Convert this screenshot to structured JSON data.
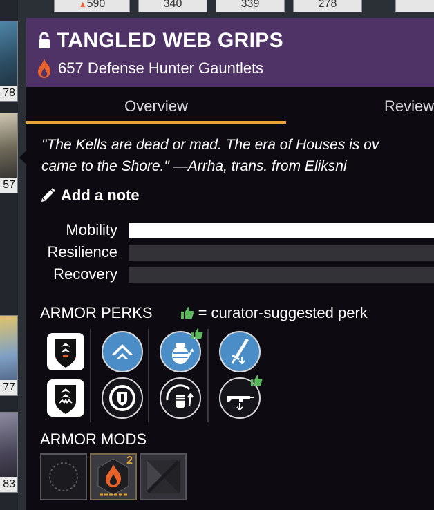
{
  "background": {
    "left_tiles": [
      "78",
      "57",
      "77",
      "83"
    ],
    "top_tiles": [
      "590",
      "340",
      "339",
      "278"
    ]
  },
  "item": {
    "name": "TANGLED WEB GRIPS",
    "power": "657",
    "subtitle": "657 Defense Hunter Gauntlets",
    "locked": true,
    "element": "solar"
  },
  "tabs": [
    {
      "label": "Overview",
      "active": true
    },
    {
      "label": "Review",
      "active": false
    }
  ],
  "flavor_text": "\"The Kells are dead or mad. The era of Houses is ov\ncame to the Shore.\" —Arrha, trans. from Eliksni",
  "add_note_label": "Add a note",
  "stats": [
    {
      "label": "Mobility",
      "value_fraction": 1.0
    },
    {
      "label": "Resilience",
      "value_fraction": 0.0
    },
    {
      "label": "Recovery",
      "value_fraction": 0.0
    }
  ],
  "perks": {
    "title": "ARMOR PERKS",
    "curator_legend": "= curator-suggested perk",
    "columns": [
      {
        "top": "armor-tier-icon",
        "bottom": "armor-tier-icon"
      },
      {
        "top": "chevron-up-icon",
        "bottom": "shield-icon"
      },
      {
        "top": "grenade-icon",
        "bottom": "fist-icon",
        "top_curated": true
      },
      {
        "top": "sword-icon",
        "bottom": "heavy-weapon-icon",
        "bottom_curated": true
      }
    ]
  },
  "mods": {
    "title": "ARMOR MODS",
    "items": [
      {
        "icon": "empty-socket-icon"
      },
      {
        "icon": "solar-energy-icon",
        "cost": "2"
      },
      {
        "icon": "empty-mod-icon"
      }
    ]
  },
  "colors": {
    "header_bg": "#4f3366",
    "popup_bg": "#0d0b11",
    "tab_underline": "#e8a534",
    "perk_blue": "#4b8ec7",
    "curator_green": "#5cb85c",
    "solar_orange": "#e9622a"
  }
}
